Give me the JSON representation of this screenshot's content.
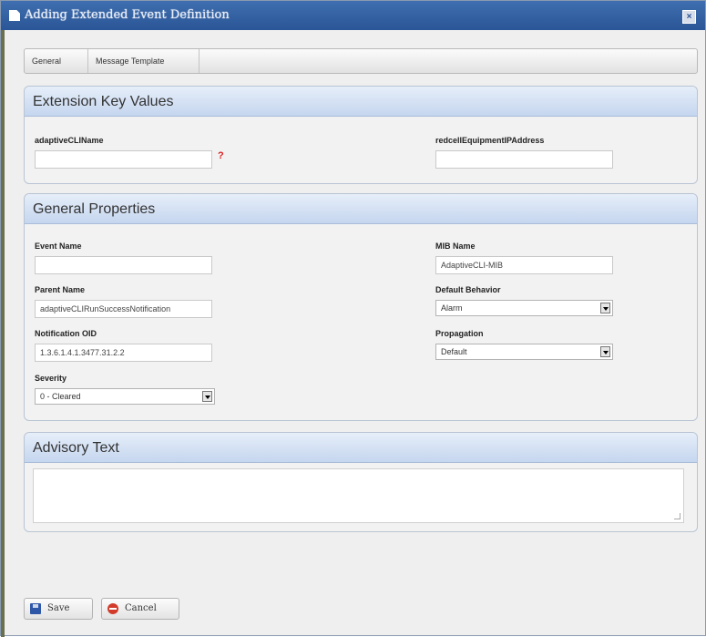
{
  "dialog": {
    "title": "Adding Extended Event Definition",
    "close_label": "×"
  },
  "tabs": [
    {
      "label": "General"
    },
    {
      "label": "Message Template"
    }
  ],
  "extension_key_values": {
    "title": "Extension Key Values",
    "adaptive_cli_name": {
      "label": "adaptiveCLIName",
      "value": "",
      "required_mark": "?"
    },
    "redcell_equipment_ip": {
      "label": "redcellEquipmentIPAddress",
      "value": ""
    }
  },
  "general_properties": {
    "title": "General Properties",
    "event_name": {
      "label": "Event Name",
      "value": ""
    },
    "mib_name": {
      "label": "MIB Name",
      "value": "AdaptiveCLI-MIB"
    },
    "parent_name": {
      "label": "Parent Name",
      "value": "adaptiveCLIRunSuccessNotification"
    },
    "default_behavior": {
      "label": "Default Behavior",
      "value": "Alarm"
    },
    "notification_oid": {
      "label": "Notification OID",
      "value": "1.3.6.1.4.1.3477.31.2.2"
    },
    "propagation": {
      "label": "Propagation",
      "value": "Default"
    },
    "severity": {
      "label": "Severity",
      "value": "0 - Cleared"
    }
  },
  "advisory_text": {
    "title": "Advisory Text",
    "value": ""
  },
  "buttons": {
    "save": "Save",
    "cancel": "Cancel"
  },
  "colors": {
    "titlebar": "#2a5596",
    "section_header": "#c5d6ef",
    "required": "#d22222",
    "save_icon": "#2f57a8",
    "cancel_icon": "#d23b2a"
  }
}
